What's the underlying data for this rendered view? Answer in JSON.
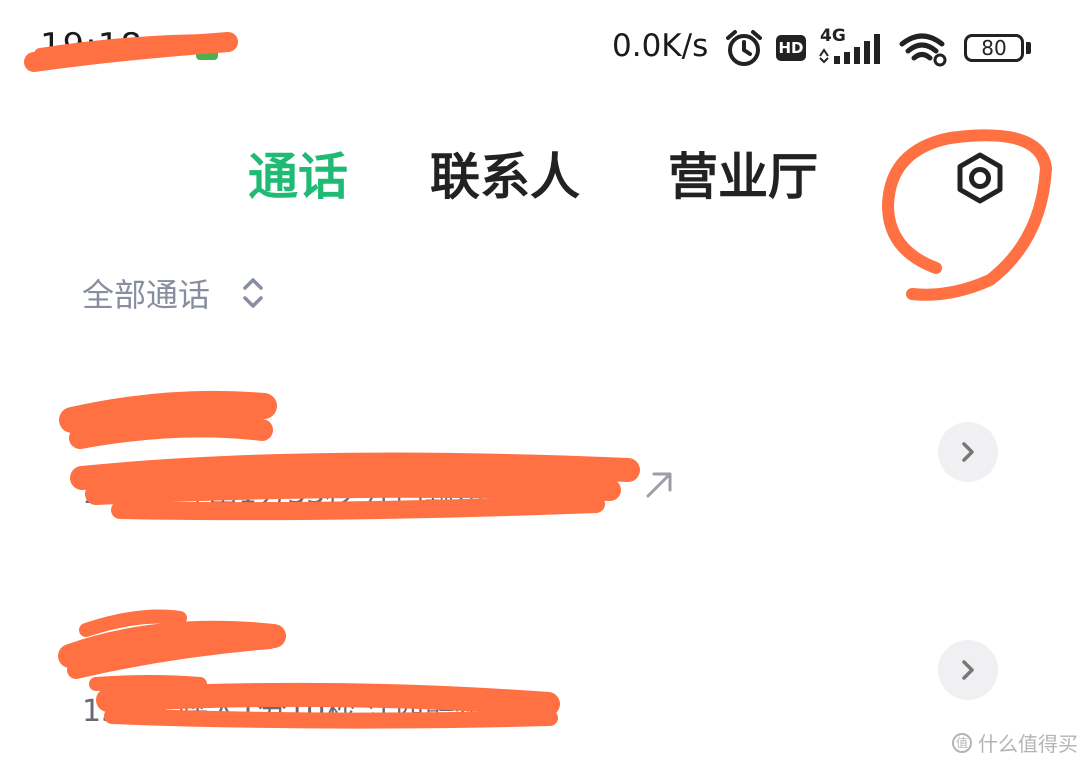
{
  "status_bar": {
    "time": "19:18",
    "network_speed": "0.0K/s",
    "hd_label": "HD",
    "network_type": "4G",
    "battery": "80",
    "icons": [
      "alarm-icon",
      "signal-icon",
      "wifi-icon"
    ]
  },
  "tabs": [
    {
      "label": "通话",
      "active": true
    },
    {
      "label": "联系人",
      "active": false
    },
    {
      "label": "营业厅",
      "active": false
    }
  ],
  "settings_icon": "gear-icon",
  "filter": {
    "label": "全部通话",
    "icon": "sort-updown-icon"
  },
  "calls": [
    {
      "name": "",
      "detail": "17:37 呼出1分33秒 江西赣州 移动",
      "direction_icon": "outgoing-arrow-icon"
    },
    {
      "name": "",
      "detail": "15:26 呼入1分10秒 江西赣州 移动"
    }
  ],
  "watermark": "值 什么值得买",
  "colors": {
    "accent": "#1fba73",
    "scribble": "#ff7043",
    "muted_text": "#888ea0"
  }
}
